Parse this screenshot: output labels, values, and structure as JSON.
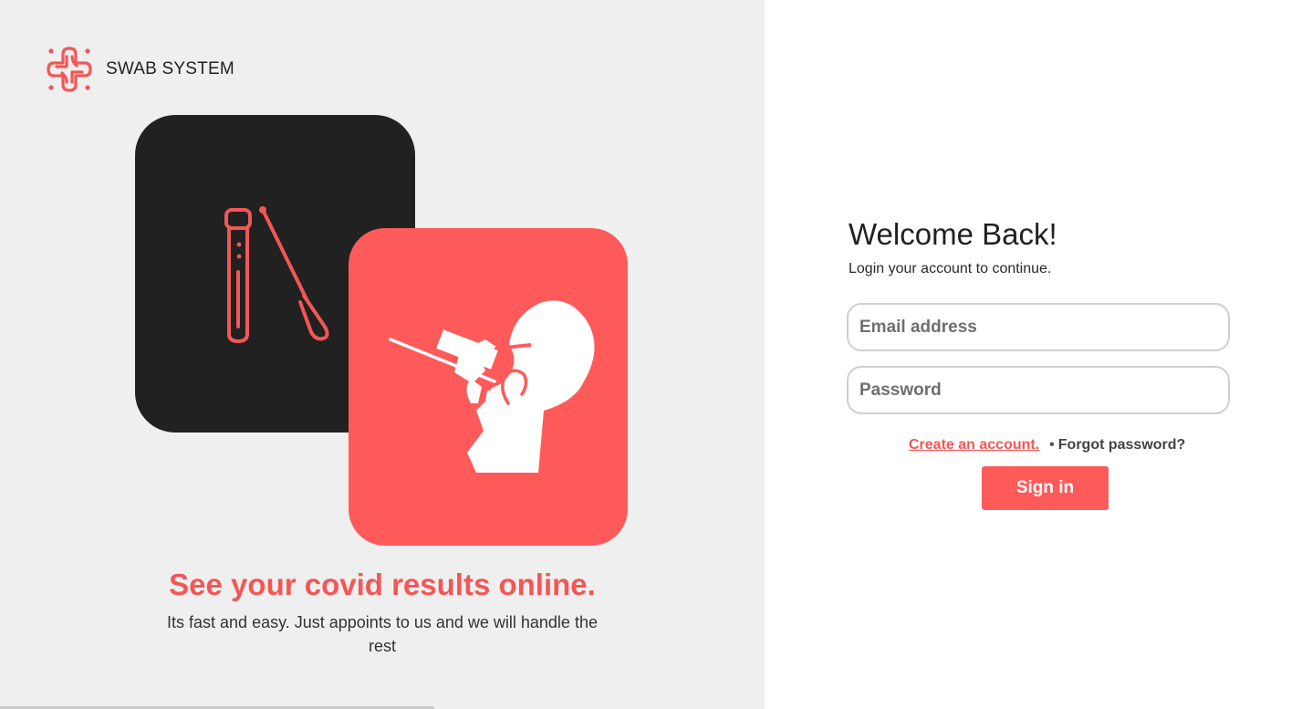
{
  "brand": {
    "name": "SWAB SYSTEM",
    "logo_icon": "medical-cross-icon",
    "color": "#f45656"
  },
  "hero": {
    "dark_card_icon": "test-tube-swab-icon",
    "red_card_icon": "nasal-swab-test-icon",
    "headline": "See your covid results online.",
    "tagline": "Its fast and easy. Just appoints to us and we will handle the rest"
  },
  "login": {
    "title": "Welcome Back!",
    "subtitle": "Login your account to continue.",
    "email_placeholder": "Email address",
    "password_placeholder": "Password",
    "create_account_label": "Create an account.",
    "separator": "•",
    "forgot_password_label": "Forgot password?",
    "sign_in_label": "Sign in"
  },
  "colors": {
    "accent": "#ff5a5a",
    "dark": "#212121",
    "left_background": "#efefef"
  }
}
